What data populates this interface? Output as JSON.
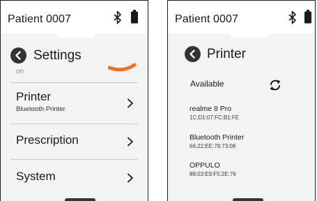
{
  "left_screen": {
    "patient_label": "Patient 0007",
    "title": "Settings",
    "hidden_item_label": "on",
    "menu": [
      {
        "title": "Printer",
        "subtitle": "Bluetooth Printer"
      },
      {
        "title": "Prescription",
        "subtitle": ""
      },
      {
        "title": "System",
        "subtitle": ""
      }
    ]
  },
  "right_screen": {
    "patient_label": "Patient 0007",
    "title": "Printer",
    "section_label": "Available",
    "devices": [
      {
        "name": "realme 8 Pro",
        "address": "1C:D1:07:FC:B1:FE"
      },
      {
        "name": "Bluetooth Printer",
        "address": "66:22:EE:78:73:08"
      },
      {
        "name": "OPPULO",
        "address": "88:03:E9:F5:2E:76"
      }
    ]
  },
  "icons": {
    "bluetooth": "bluetooth-icon",
    "battery": "battery-icon",
    "back": "back-arrow-icon",
    "chevron": "chevron-right-icon",
    "refresh": "refresh-icon"
  },
  "colors": {
    "accent": "#f07020",
    "screen_bg": "#f3f3f3",
    "header_bg": "#ffffff",
    "text": "#1a1a1a",
    "divider": "#c9c9c9"
  }
}
